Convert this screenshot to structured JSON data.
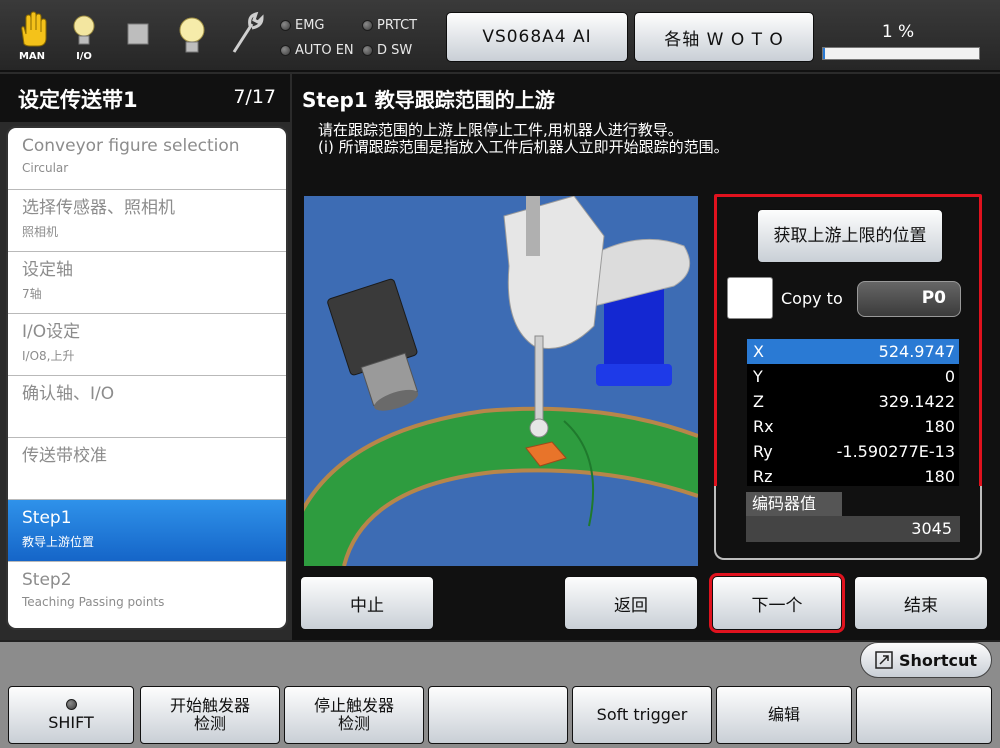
{
  "topbar": {
    "icons": [
      {
        "name": "hand-icon",
        "caption": "MAN"
      },
      {
        "name": "lightbulb-icon",
        "caption": "I/O"
      },
      {
        "name": "stop-square-icon",
        "caption": ""
      },
      {
        "name": "lamp-icon",
        "caption": ""
      },
      {
        "name": "wrench-icon",
        "caption": ""
      }
    ],
    "indicators": {
      "emg": "EMG",
      "prtct": "PRTCT",
      "auto_en": "AUTO EN",
      "dsw": "D SW"
    },
    "robot_button": "VS068A4 AI",
    "axis_button": "各轴  W O T O",
    "speed_label": "1 %",
    "speed_value": 1
  },
  "left": {
    "title": "设定传送带1",
    "page_count": "7/17",
    "steps": [
      {
        "main": "Conveyor figure selection",
        "sub": "Circular"
      },
      {
        "main": "选择传感器、照相机",
        "sub": "照相机"
      },
      {
        "main": "设定轴",
        "sub": "7轴"
      },
      {
        "main": "I/O设定",
        "sub": "I/O8,上升"
      },
      {
        "main": "确认轴、I/O",
        "sub": ""
      },
      {
        "main": "传送带校准",
        "sub": ""
      },
      {
        "main": "Step1",
        "sub": "教导上游位置"
      },
      {
        "main": "Step2",
        "sub": "Teaching Passing points"
      }
    ]
  },
  "main": {
    "title": "Step1 教导跟踪范围的上游",
    "instr_line1": "请在跟踪范围的上游上限停止工件,用机器人进行教导。",
    "instr_line2": "(i) 所谓跟踪范围是指放入工件后机器人立即开始跟踪的范围。",
    "acquire_button": "获取上游上限的位置",
    "copy_label": "Copy to",
    "copy_target": "P0",
    "coords": [
      {
        "label": "X",
        "value": "524.9747"
      },
      {
        "label": "Y",
        "value": "0"
      },
      {
        "label": "Z",
        "value": "329.1422"
      },
      {
        "label": "Rx",
        "value": "180"
      },
      {
        "label": "Ry",
        "value": "-1.590277E-13"
      },
      {
        "label": "Rz",
        "value": "180"
      }
    ],
    "encoder_label": "编码器值",
    "encoder_value": "3045",
    "buttons": {
      "abort": "中止",
      "back": "返回",
      "next": "下一个",
      "finish": "结束"
    }
  },
  "bottom": {
    "shortcut": "Shortcut",
    "fkeys": [
      "SHIFT",
      "开始触发器检测",
      "停止触发器检测",
      "",
      "Soft trigger",
      "编辑",
      ""
    ]
  },
  "colors": {
    "accent_blue": "#2a7ad4",
    "highlight_red": "#e0121e",
    "conveyor_green": "#2e9c3f",
    "robot_blue": "#1428d2"
  }
}
